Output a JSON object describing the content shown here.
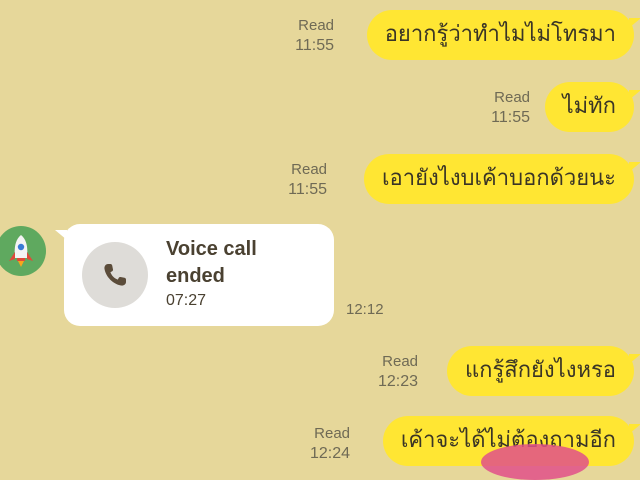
{
  "messages": [
    {
      "read": "Read",
      "time": "11:55",
      "text": "อยากรู้ว่าทำไมไม่โทรมา"
    },
    {
      "read": "Read",
      "time": "11:55",
      "text": "ไม่ทัก"
    },
    {
      "read": "Read",
      "time": "11:55",
      "text": "เอายังไงบเค้าบอกด้วยนะ"
    },
    {
      "read": "Read",
      "time": "12:23",
      "text": "แกรู้สึกยังไงหรอ"
    },
    {
      "read": "Read",
      "time": "12:24",
      "text": "เค้าจะได้ไม่ต้องถามอีก"
    }
  ],
  "call": {
    "title": "Voice call ended",
    "duration": "07:27",
    "time": "12:12"
  },
  "colors": {
    "background": "#e6d79a",
    "outgoing_bubble": "#ffe633",
    "incoming_bubble": "#ffffff",
    "avatar": "#5fa95f"
  },
  "icons": {
    "avatar": "rocket-icon",
    "call": "phone-icon"
  }
}
